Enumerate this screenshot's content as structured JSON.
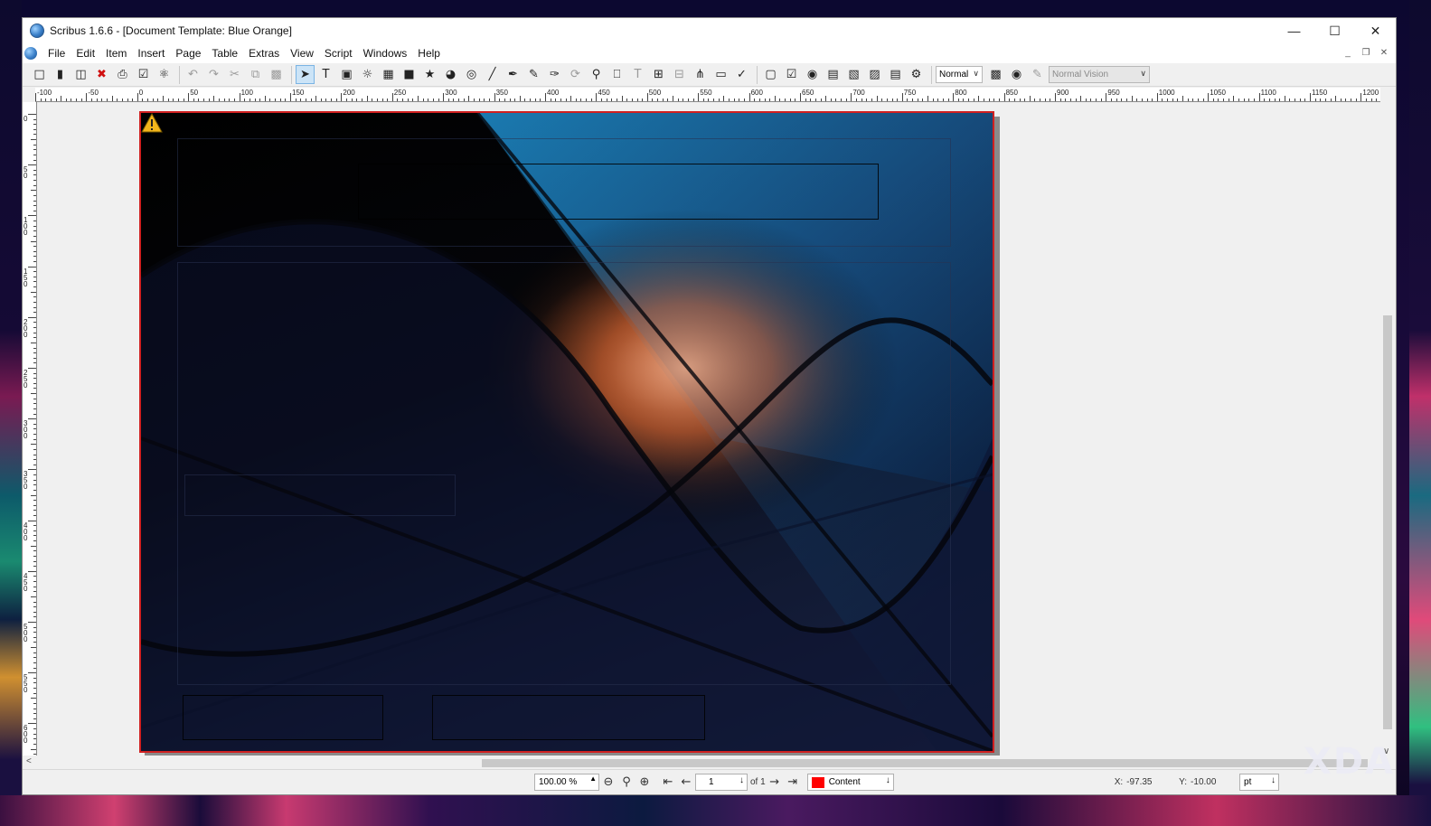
{
  "window": {
    "title": "Scribus 1.6.6 - [Document Template: Blue Orange]",
    "controls": [
      "minimize",
      "maximize",
      "close"
    ]
  },
  "menubar": {
    "items": [
      "File",
      "Edit",
      "Item",
      "Insert",
      "Page",
      "Table",
      "Extras",
      "View",
      "Script",
      "Windows",
      "Help"
    ]
  },
  "toolbar": {
    "image_mode": "Normal",
    "vision_mode": "Normal Vision"
  },
  "ruler": {
    "horizontal_labels": [
      "-100",
      "-50",
      "0",
      "50",
      "100",
      "150",
      "200",
      "250",
      "300",
      "350",
      "400",
      "450",
      "500",
      "550",
      "600",
      "650",
      "700",
      "750",
      "800",
      "850",
      "900",
      "950",
      "1000",
      "1050",
      "1100",
      "1150",
      "1200"
    ],
    "vertical_labels": [
      "0",
      "50",
      "100",
      "150",
      "200",
      "250",
      "300",
      "350",
      "400",
      "450",
      "500",
      "550",
      "600"
    ]
  },
  "statusbar": {
    "zoom": "100.00 %",
    "page_current": "1",
    "page_of": "of 1",
    "layer": "Content",
    "layer_color": "#ff0000",
    "x_label": "X:",
    "x_value": "-97.35",
    "y_label": "Y:",
    "y_value": "-10.00",
    "unit": "pt"
  },
  "watermark": {
    "text": "XDA"
  }
}
